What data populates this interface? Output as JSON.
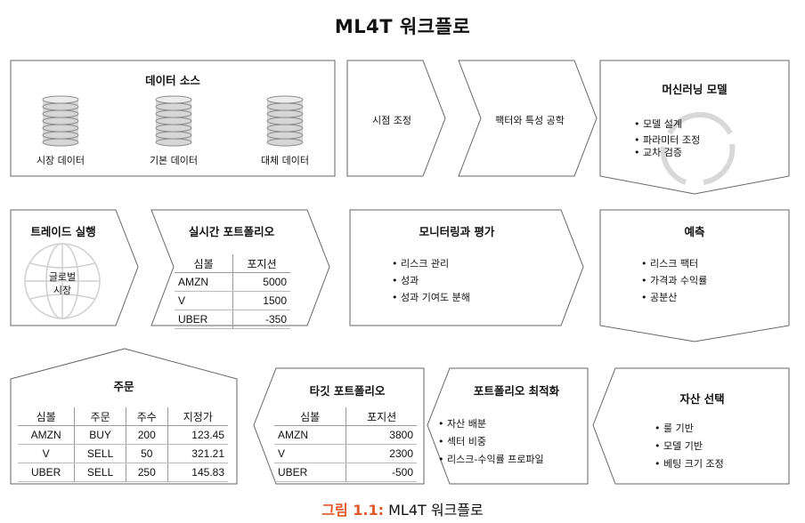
{
  "title": "ML4T 워크플로",
  "caption": {
    "label": "그림 1.1:",
    "text": " ML4T 워크플로"
  },
  "data_source": {
    "title": "데이터 소스",
    "items": [
      "시장 데이터",
      "기본 데이터",
      "대체 데이터"
    ]
  },
  "time_adjust": {
    "title": "시점 조정"
  },
  "factor": {
    "title": "팩터와 특성 공학"
  },
  "ml_model": {
    "title": "머신러닝 모델",
    "bullets": [
      "모델 설계",
      "파라미터 조정",
      "교차 검증"
    ]
  },
  "trade": {
    "title": "트레이드 실행",
    "globe_label": "글로벌\n시장"
  },
  "realtime": {
    "title": "실시간 포트폴리오",
    "headers": [
      "심볼",
      "포지션"
    ],
    "rows": [
      [
        "AMZN",
        "5000"
      ],
      [
        "V",
        "1500"
      ],
      [
        "UBER",
        "-350"
      ]
    ]
  },
  "monitor": {
    "title": "모니터링과 평가",
    "bullets": [
      "리스크 관리",
      "성과",
      "성과 기여도 분해"
    ]
  },
  "predict": {
    "title": "예측",
    "bullets": [
      "리스크 팩터",
      "가격과 수익률",
      "공분산"
    ]
  },
  "order": {
    "title": "주문",
    "headers": [
      "심볼",
      "주문",
      "주수",
      "지정가"
    ],
    "rows": [
      [
        "AMZN",
        "BUY",
        "200",
        "123.45"
      ],
      [
        "V",
        "SELL",
        "50",
        "321.21"
      ],
      [
        "UBER",
        "SELL",
        "250",
        "145.83"
      ]
    ]
  },
  "target": {
    "title": "타깃 포트폴리오",
    "headers": [
      "심볼",
      "포지션"
    ],
    "rows": [
      [
        "AMZN",
        "3800"
      ],
      [
        "V",
        "2300"
      ],
      [
        "UBER",
        "-500"
      ]
    ]
  },
  "optimize": {
    "title": "포트폴리오 최적화",
    "bullets": [
      "자산 배분",
      "섹터 비중",
      "리스크-수익률 프로파일"
    ]
  },
  "asset_select": {
    "title": "자산 선택",
    "bullets": [
      "룰 기반",
      "모델 기반",
      "베팅 크기 조정"
    ]
  }
}
